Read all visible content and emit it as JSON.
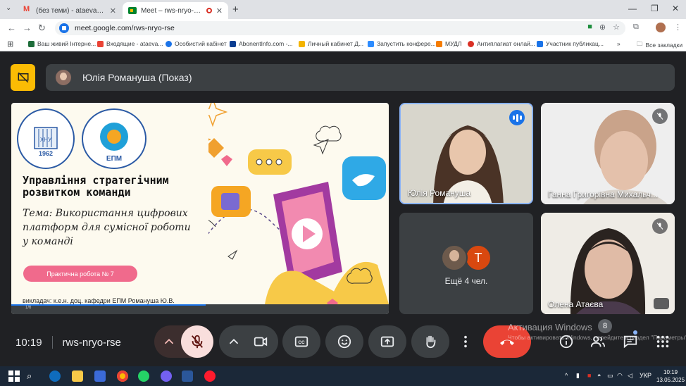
{
  "browser": {
    "tabs": [
      {
        "label": "(без теми) - ataeva.elena.uipa@...",
        "icon": "gmail-icon",
        "active": false
      },
      {
        "label": "Meet – rws-nryo-rse",
        "icon": "meet-icon",
        "active": true
      }
    ],
    "url": "meet.google.com/rws-nryo-rse",
    "bookmarks": [
      "Ваш живий Інтерне...",
      "Входящие - ataeva...",
      "Особистий кабінет",
      "AbonentInfo.com -...",
      "Личный кабинет Д...",
      "Запустить конфере...",
      "МУДЛ",
      "Антиплагиат онлай...",
      "Участник публикац..."
    ],
    "all_bookmarks": "Все закладки"
  },
  "meet": {
    "presenter_label": "Юлія Романуша (Показ)",
    "slide": {
      "logo1_text": "ХНУ",
      "logo1_year": "1962",
      "logo2_text": "ЕПМ",
      "title": "Управління стратегічним розвитком команди",
      "theme": "Тема: Використання цифрових платформ для сумісної роботи у команді",
      "practical_button": "Практична робота № 7",
      "lecturer": "викладач: к.е.н. доц. кафедри ЕПМ Романуша Ю.В.",
      "page": "1/6"
    },
    "tiles": [
      {
        "name": "Юлія Романуша",
        "state": "speaking"
      },
      {
        "name": "Ганна Григорівна Михальч...",
        "state": "muted"
      },
      {
        "more_label": "Ещё 4 чел.",
        "avatar_letter": "Т"
      },
      {
        "name": "Олена Атаєва",
        "state": "muted"
      }
    ],
    "time": "10:19",
    "meeting_code": "rws-nryo-rse",
    "participants_count": "8",
    "activation_title": "Активация Windows",
    "activation_sub": "Чтобы активировать Windows, перейдите в раздел \"Параметры\"."
  },
  "taskbar": {
    "lang": "УКР",
    "time": "10:19",
    "date": "13.05.2025"
  },
  "colors": {
    "meet_bg": "#202124",
    "tile_bg": "#3c4043",
    "end_call": "#ea4335",
    "mic_off_bg": "#f9dedc",
    "present_accent": "#fbbc04"
  }
}
